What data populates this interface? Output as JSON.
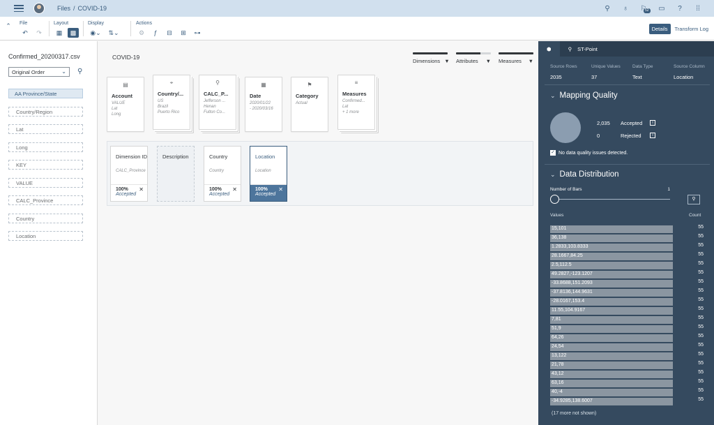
{
  "shell": {
    "breadcrumb_root": "Files",
    "breadcrumb_sep": "/",
    "breadcrumb_current": "COVID-19",
    "notification_count": "52"
  },
  "toolbar": {
    "file_label": "File",
    "layout_label": "Layout",
    "display_label": "Display",
    "actions_label": "Actions",
    "details_label": "Details",
    "transform_log_label": "Transform Log"
  },
  "left": {
    "file_name": "Confirmed_20200317.csv",
    "sort_value": "Original Order",
    "columns": [
      {
        "label": "AA  Province/State",
        "selected": true
      },
      {
        "label": "Country/Region"
      },
      {
        "label": "Lat"
      },
      {
        "label": "Long"
      },
      {
        "label": "KEY"
      },
      {
        "label": "VALUE"
      },
      {
        "label": "CALC_Province"
      },
      {
        "label": "Country"
      },
      {
        "label": "Location"
      }
    ]
  },
  "main": {
    "title": "COVID-19",
    "legend": {
      "dimensions": "Dimensions",
      "attributes": "Attributes",
      "measures": "Measures",
      "caret": "▼"
    },
    "cards": [
      {
        "name": "Account",
        "sub1": "VALUE",
        "sub2": "Lat",
        "sub3": "Long",
        "icon": "▤"
      },
      {
        "name": "Country/...",
        "sub1": "US",
        "sub2": "Brazil",
        "sub3": "Puerto Rico",
        "icon": "⌖"
      },
      {
        "name": "CALC_P...",
        "sub1": "Jefferson ...",
        "sub2": "Henan",
        "sub3": "Fulton Co...",
        "icon": "⚲"
      },
      {
        "name": "Date",
        "sub1": "2020/01/22",
        "sub2": "- 2020/03/16",
        "sub3": "",
        "icon": "▦"
      },
      {
        "name": "Category",
        "sub1": "Actual",
        "sub2": "",
        "sub3": "",
        "icon": "⚑"
      },
      {
        "name": "Measures",
        "sub1": "Confirmed...",
        "sub2": "Lat",
        "sub3": "+ 1 more",
        "icon": "≡"
      }
    ],
    "detail_cards": [
      {
        "name": "Dimension ID",
        "sub": "CALC_Province",
        "pct": "100%",
        "status": "Accepted"
      },
      {
        "name": "Description",
        "sub": "",
        "pct": "",
        "status": ""
      },
      {
        "name": "Country",
        "sub": "Country",
        "pct": "100%",
        "status": "Accepted"
      },
      {
        "name": "Location",
        "sub": "Location",
        "pct": "100%",
        "status": "Accepted"
      }
    ]
  },
  "right": {
    "tab_point": "ST-Point",
    "stats": [
      {
        "k": "Source Rows",
        "v": "2035"
      },
      {
        "k": "Unique Values",
        "v": "37"
      },
      {
        "k": "Data Type",
        "v": "Text"
      },
      {
        "k": "Source Column",
        "v": "Location"
      }
    ],
    "mapping_title": "Mapping Quality",
    "accepted_count": "2,035",
    "accepted_label": "Accepted",
    "rejected_count": "0",
    "rejected_label": "Rejected",
    "no_issues": "No data quality issues detected.",
    "distribution_title": "Data Distribution",
    "number_of_bars_label": "Number of Bars",
    "number_of_bars_value": "1",
    "values_header": "Values",
    "count_header": "Count",
    "rows": [
      {
        "v": "15,101",
        "c": "55"
      },
      {
        "v": "36,138",
        "c": "55"
      },
      {
        "v": "1.2833,103.8333",
        "c": "55"
      },
      {
        "v": "28.1667,84.25",
        "c": "55"
      },
      {
        "v": "2.5,112.5",
        "c": "55"
      },
      {
        "v": "49.2827,-123.1207",
        "c": "55"
      },
      {
        "v": "-33.8688,151.2093",
        "c": "55"
      },
      {
        "v": "-37.8136,144.9631",
        "c": "55"
      },
      {
        "v": "-28.0167,153.4",
        "c": "55"
      },
      {
        "v": "11.55,104.9167",
        "c": "55"
      },
      {
        "v": "7,81",
        "c": "55"
      },
      {
        "v": "51,9",
        "c": "55"
      },
      {
        "v": "64,26",
        "c": "55"
      },
      {
        "v": "24,54",
        "c": "55"
      },
      {
        "v": "13,122",
        "c": "55"
      },
      {
        "v": "21,78",
        "c": "55"
      },
      {
        "v": "43,12",
        "c": "55"
      },
      {
        "v": "63,16",
        "c": "55"
      },
      {
        "v": "40,-4",
        "c": "55"
      },
      {
        "v": "-34.9285,138.6007",
        "c": "55"
      }
    ],
    "more_text": "(17 more not shown)"
  }
}
